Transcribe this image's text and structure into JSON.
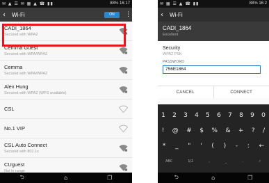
{
  "left_screen": {
    "status_icons": "✉ ▲ ☰ ✉ ▦ ▲ ☎ ▮▮",
    "status_right": "88% 16:17",
    "header_title": "Wi-Fi",
    "toggle_label": "ON",
    "networks": [
      {
        "name": "CADI_1864",
        "security": "Secured with WPA2"
      },
      {
        "name": "Cemma Guest",
        "security": "Secured with WPA/WPA2"
      },
      {
        "name": "Cemma",
        "security": "Secured with WPA/WPA2"
      },
      {
        "name": "Alex Hung",
        "security": "Secured with WPA2 (WPS available)"
      },
      {
        "name": "CSL",
        "security": ""
      },
      {
        "name": "No.1 VIP",
        "security": ""
      },
      {
        "name": "CSL Auto Connect",
        "security": "Secured with 802.1x"
      },
      {
        "name": "CUguest",
        "security": "Not in range"
      }
    ]
  },
  "right_screen": {
    "status_icons": "✉ ▦ ☰ ▲ ☎ ▮▮",
    "status_right": "88% 16:2",
    "header_title": "Wi-Fi",
    "dialog": {
      "title": "CADI_1864",
      "subtitle": "Excellent",
      "security_label": "Security",
      "security_value": "WPA2 PSK",
      "password_label": "PASSWORD",
      "password_value": "756E1864",
      "cancel_label": "CANCEL",
      "connect_label": "CONNECT"
    },
    "keyboard": {
      "row1": [
        "1",
        "2",
        "3",
        "4",
        "5",
        "6",
        "7",
        "8",
        "9",
        "0"
      ],
      "row2": [
        "!",
        "@",
        "#",
        "$",
        "%",
        "&",
        "+",
        "?",
        "/"
      ],
      "row3": [
        "*",
        "_",
        "\"",
        "'",
        "(",
        ")",
        "-",
        ":",
        "←"
      ],
      "row4": [
        "ABC",
        "1/2",
        ",",
        "_",
        ".",
        "✓"
      ]
    }
  },
  "colors": {
    "highlight": "#e8151b",
    "accent": "#2b87c9",
    "appbar": "#3a3a3a"
  },
  "icons": {
    "back": "‹",
    "overflow": "⋮",
    "nav_back": "⮌",
    "nav_home": "⌂",
    "nav_recent": "❐"
  }
}
